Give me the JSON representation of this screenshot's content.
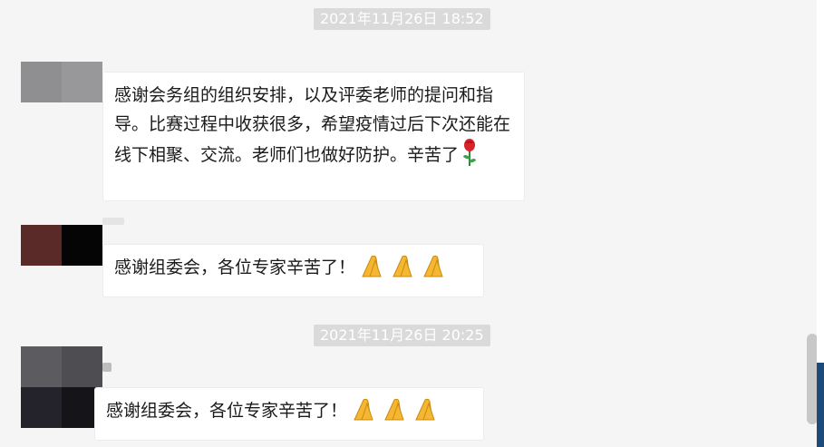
{
  "timestamps": [
    "2021年11月26日 18:52",
    "2021年11月26日 20:25"
  ],
  "messages": [
    {
      "text": "感谢会务组的组织安排，以及评委老师的提问和指导。比赛过程中收获很多，希望疫情过后下次还能在线下相聚、交流。老师们也做好防护。辛苦了",
      "emoji": "rose-emoji"
    },
    {
      "text": "感谢组委会，各位专家辛苦了！",
      "emoji": "pray-emoji"
    },
    {
      "text": "感谢组委会，各位专家辛苦了！",
      "emoji": "pray-emoji"
    }
  ],
  "colors": {
    "background": "#f5f5f5",
    "bubble": "#ffffff",
    "timestamp_bg": "#dadada",
    "avatar1": [
      "#8f8f92",
      "#98989b"
    ],
    "avatar2": [
      "#5a2a28",
      "#050505"
    ],
    "avatar3": [
      "#5c5c60",
      "#4d4d52",
      "#24232b",
      "#151419"
    ]
  }
}
